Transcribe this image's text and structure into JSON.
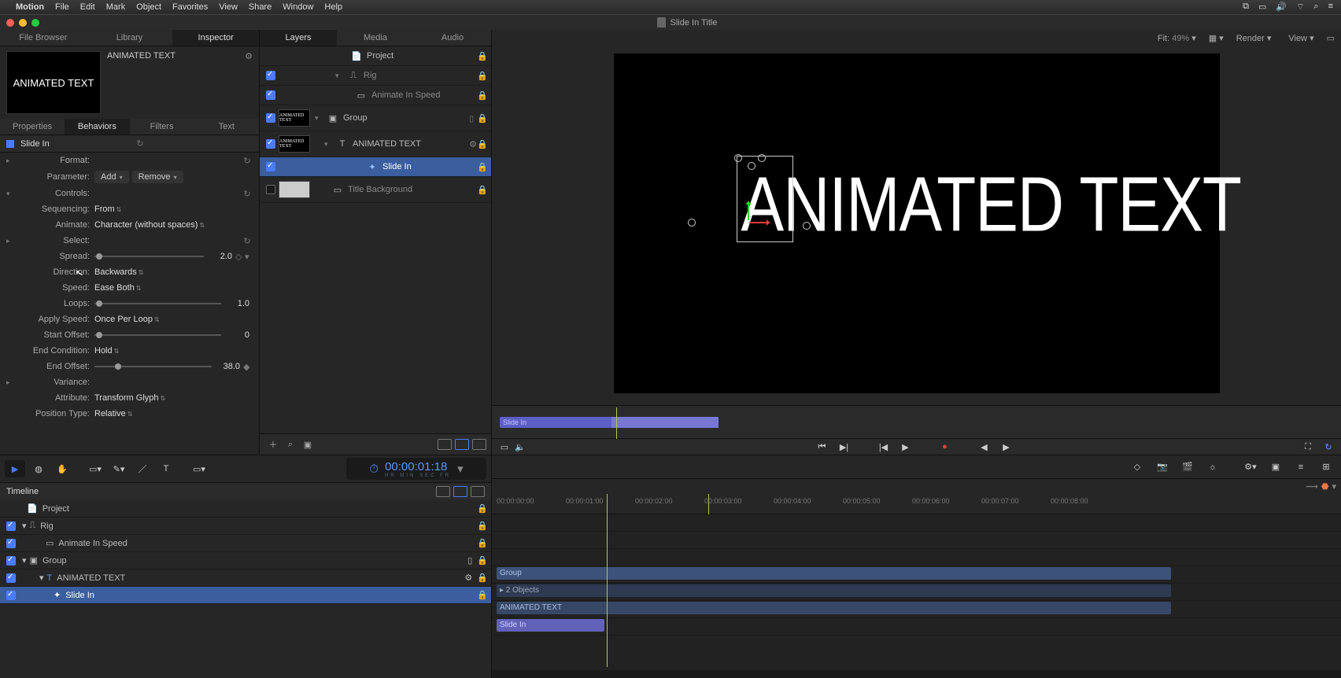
{
  "menubar": {
    "app": "Motion",
    "items": [
      "File",
      "Edit",
      "Mark",
      "Object",
      "Favorites",
      "View",
      "Share",
      "Window",
      "Help"
    ]
  },
  "window_title": "Slide In Title",
  "left_tabs": [
    "File Browser",
    "Library",
    "Inspector"
  ],
  "left_active_tab": 2,
  "preview": {
    "name": "ANIMATED TEXT",
    "thumb_text": "ANIMATED TEXT"
  },
  "insp_tabs": [
    "Properties",
    "Behaviors",
    "Filters",
    "Text"
  ],
  "insp_active": 1,
  "behavior": {
    "name": "Slide In",
    "format_label": "Format:",
    "parameter_label": "Parameter:",
    "add_btn": "Add",
    "remove_btn": "Remove",
    "controls_label": "Controls:",
    "rows": {
      "sequencing": {
        "label": "Sequencing:",
        "value": "From"
      },
      "animate": {
        "label": "Animate:",
        "value": "Character (without spaces)"
      },
      "select": {
        "label": "Select:",
        "value": ""
      },
      "spread": {
        "label": "Spread:",
        "value": "2.0"
      },
      "direction": {
        "label": "Direction:",
        "value": "Backwards"
      },
      "speed": {
        "label": "Speed:",
        "value": "Ease Both"
      },
      "loops": {
        "label": "Loops:",
        "value": "1.0"
      },
      "apply_speed": {
        "label": "Apply Speed:",
        "value": "Once Per Loop"
      },
      "start_offset": {
        "label": "Start Offset:",
        "value": "0"
      },
      "end_condition": {
        "label": "End Condition:",
        "value": "Hold"
      },
      "end_offset": {
        "label": "End Offset:",
        "value": "38.0"
      },
      "variance": {
        "label": "Variance:",
        "value": ""
      },
      "attribute": {
        "label": "Attribute:",
        "value": "Transform Glyph"
      },
      "position_type": {
        "label": "Position Type:",
        "value": "Relative"
      }
    }
  },
  "layers_tabs": [
    "Layers",
    "Media",
    "Audio"
  ],
  "layers_active": 0,
  "layers": {
    "project": "Project",
    "rig": "Rig",
    "animate_speed": "Animate In Speed",
    "group": "Group",
    "animated_text": "ANIMATED TEXT",
    "slide_in": "Slide In",
    "title_bg": "Title Background"
  },
  "canvas": {
    "fit_label": "Fit:",
    "fit_pct": "49%",
    "render_label": "Render",
    "view_label": "View",
    "big_text": "ANIMATED TEXT"
  },
  "mini_clip": "Slide In",
  "timecode": "00:00:01:18",
  "timecode_labels": "HR   MIN   SEC   FR",
  "timeline_label": "Timeline",
  "timeline_tracks": {
    "project": "Project",
    "rig": "Rig",
    "animate_speed": "Animate In Speed",
    "group": "Group",
    "animated_text": "ANIMATED TEXT",
    "slide_in": "Slide In"
  },
  "ruler": [
    "00:00:00:00",
    "00:00:01:00",
    "00:00:02:00",
    "00:00:03:00",
    "00:00:04:00",
    "00:00:05:00",
    "00:00:06:00",
    "00:00:07:00",
    "00:00:08:00"
  ],
  "tl_clips": {
    "group": "Group",
    "objects": "▸ 2 Objects",
    "animated_text": "ANIMATED TEXT",
    "slide_in": "Slide In"
  }
}
